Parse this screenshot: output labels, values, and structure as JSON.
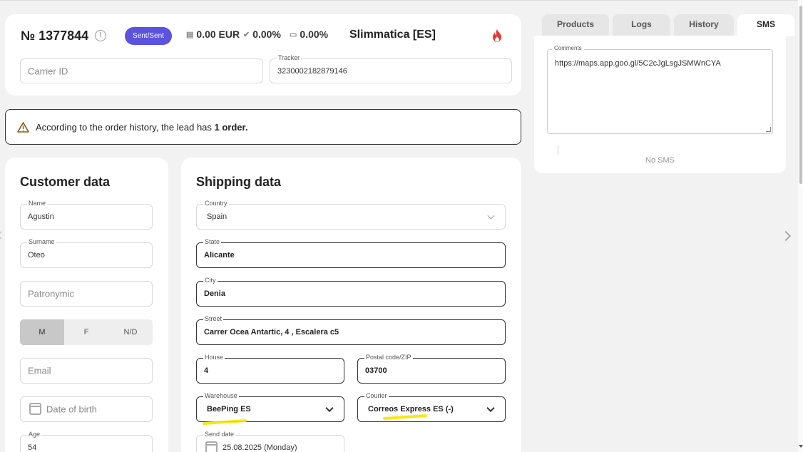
{
  "header": {
    "order_number": "№ 1377844",
    "status": "Sent/Sent",
    "amount": "0.00 EUR",
    "percent1": "0.00%",
    "percent2": "0.00%",
    "offer": "Slimmatica [ES]",
    "carrier_placeholder": "Carrier ID",
    "tracker_label": "Tracker",
    "tracker_value": "3230002182879146"
  },
  "alert": {
    "text_prefix": "According to the order history, the lead has ",
    "text_bold": "1 order."
  },
  "customer": {
    "title": "Customer data",
    "name_label": "Name",
    "name_value": "Agustin",
    "surname_label": "Surname",
    "surname_value": "Oteo",
    "patronymic_placeholder": "Patronymic",
    "gender_options": [
      "M",
      "F",
      "N/D"
    ],
    "gender_selected": "M",
    "email_placeholder": "Email",
    "dob_placeholder": "Date of birth",
    "age_label": "Age",
    "age_value": "54"
  },
  "shipping": {
    "title": "Shipping data",
    "country_label": "Country",
    "country_value": "Spain",
    "state_label": "State",
    "state_value": "Alicante",
    "city_label": "City",
    "city_value": "Denia",
    "street_label": "Street",
    "street_value": "Carrer Ocea Antartic, 4 , Escalera c5",
    "house_label": "House",
    "house_value": "4",
    "postal_label": "Postal code/ZIP",
    "postal_value": "03700",
    "warehouse_label": "Warehouse",
    "warehouse_value": "BeePing ES",
    "courier_label": "Courier",
    "courier_value": "Correos Express ES (-)",
    "send_date_label": "Send date",
    "send_date_value": "25.08.2025 (Monday)"
  },
  "tabs": [
    "Products",
    "Logs",
    "History",
    "SMS"
  ],
  "active_tab": "SMS",
  "sms": {
    "comments_label": "Comments",
    "comments_value": "https://maps.app.goo.gl/5C2cJgLsgJSMWnCYA",
    "empty_text": "No SMS"
  },
  "colors": {
    "status_badge": "#5b52e0",
    "highlight": "#f5e400",
    "fire": "#e53935",
    "warning": "#8a5a14"
  }
}
